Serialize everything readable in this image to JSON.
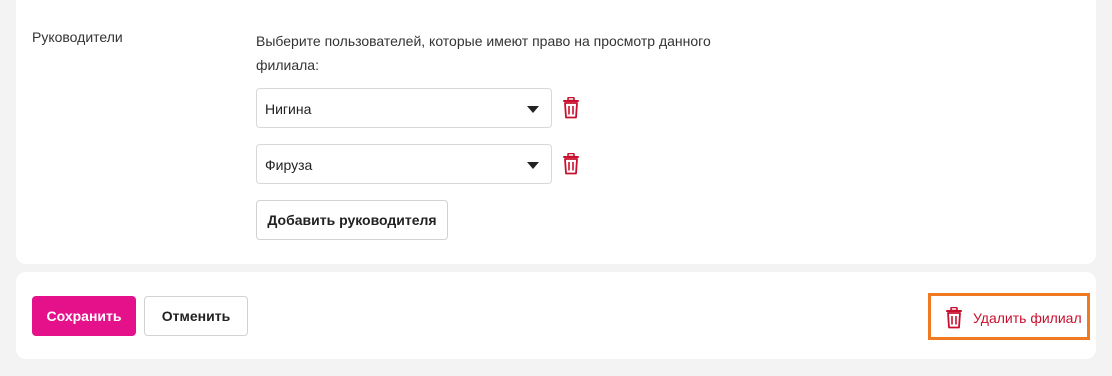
{
  "managers_section": {
    "label": "Руководители",
    "description": "Выберите пользователей, которые имеют право на просмотр данного филиала:",
    "selects": [
      {
        "value": "Нигина",
        "caret_icon": "caret-down-icon",
        "remove_icon": "trash-icon"
      },
      {
        "value": "Фируза",
        "caret_icon": "caret-down-icon",
        "remove_icon": "trash-icon"
      }
    ],
    "add_button_label": "Добавить руководителя"
  },
  "footer": {
    "save_label": "Сохранить",
    "cancel_label": "Отменить",
    "delete_branch_label": "Удалить филиал",
    "delete_icon": "trash-icon"
  },
  "colors": {
    "background": "#f2f3f2",
    "primary": "#e5118b",
    "danger": "#c8102e",
    "highlight": "#f07a22"
  }
}
